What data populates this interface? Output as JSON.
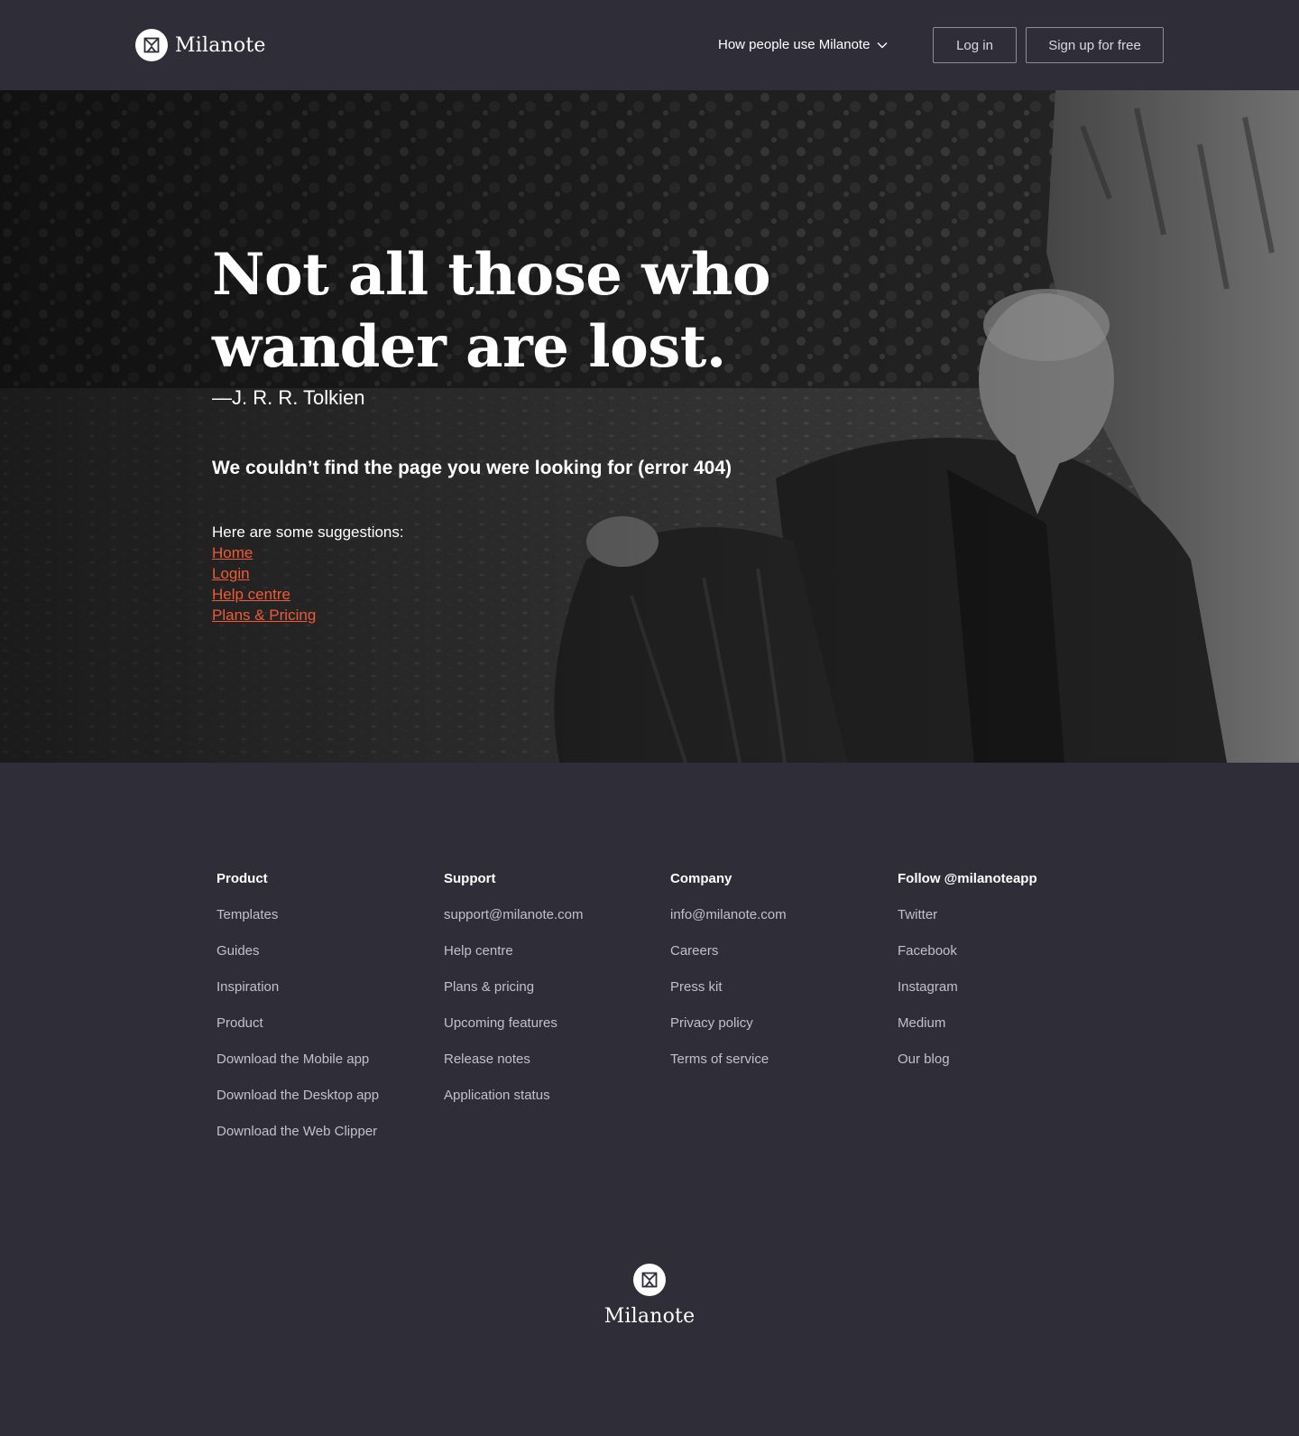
{
  "header": {
    "brand": "Milanote",
    "nav_dropdown": "How people use Milanote",
    "login": "Log in",
    "signup": "Sign up for free"
  },
  "hero": {
    "quote_line1": "Not all those who",
    "quote_line2": "wander are lost.",
    "author": "—J. R. R. Tolkien",
    "error": "We couldn’t find the page you were looking for (error 404)",
    "suggestions_intro": "Here are some suggestions:",
    "suggestions": [
      "Home",
      "Login",
      "Help centre",
      "Plans & Pricing"
    ],
    "link_color": "#f05a36"
  },
  "footer": {
    "columns": [
      {
        "heading": "Product",
        "links": [
          "Templates",
          "Guides",
          "Inspiration",
          "Product",
          "Download the Mobile app",
          "Download the Desktop app",
          "Download the Web Clipper"
        ]
      },
      {
        "heading": "Support",
        "links": [
          "support@milanote.com",
          "Help centre",
          "Plans & pricing",
          "Upcoming features",
          "Release notes",
          "Application status"
        ]
      },
      {
        "heading": "Company",
        "links": [
          "info@milanote.com",
          "Careers",
          "Press kit",
          "Privacy policy",
          "Terms of service"
        ]
      },
      {
        "heading": "Follow @milanoteapp",
        "links": [
          "Twitter",
          "Facebook",
          "Instagram",
          "Medium",
          "Our blog"
        ]
      }
    ],
    "brand": "Milanote"
  },
  "colors": {
    "background": "#2f2d38",
    "accent": "#f05a36"
  }
}
